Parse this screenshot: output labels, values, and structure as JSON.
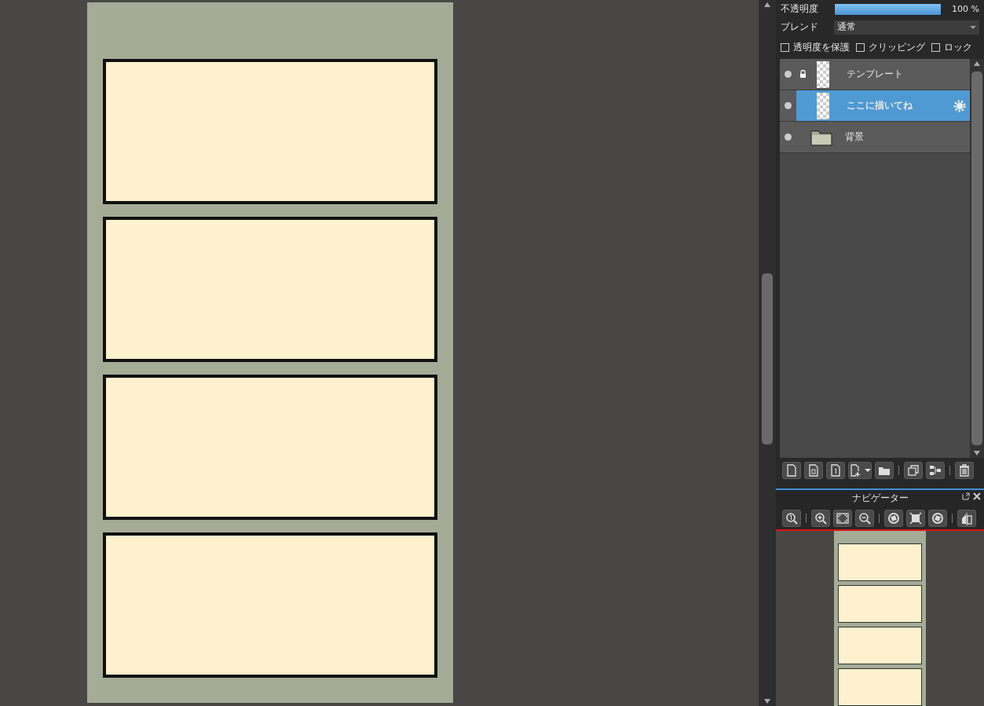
{
  "layer_panel": {
    "opacity": {
      "label": "不透明度",
      "level": 1.0,
      "reading": "100 %"
    },
    "blend": {
      "label": "ブレンド",
      "value": "通常"
    },
    "options": [
      {
        "label": "透明度を保護",
        "checked": false
      },
      {
        "label": "クリッピング",
        "checked": false
      },
      {
        "label": "ロック",
        "checked": false
      }
    ],
    "layers": [
      {
        "name": "テンプレート",
        "kind": "layer",
        "locked": true,
        "selected": false
      },
      {
        "name": "ここに描いてね",
        "kind": "layer",
        "locked": false,
        "selected": true
      },
      {
        "name": "背景",
        "kind": "folder",
        "locked": false,
        "selected": false
      }
    ]
  },
  "navigator": {
    "title": "ナビゲーター"
  }
}
